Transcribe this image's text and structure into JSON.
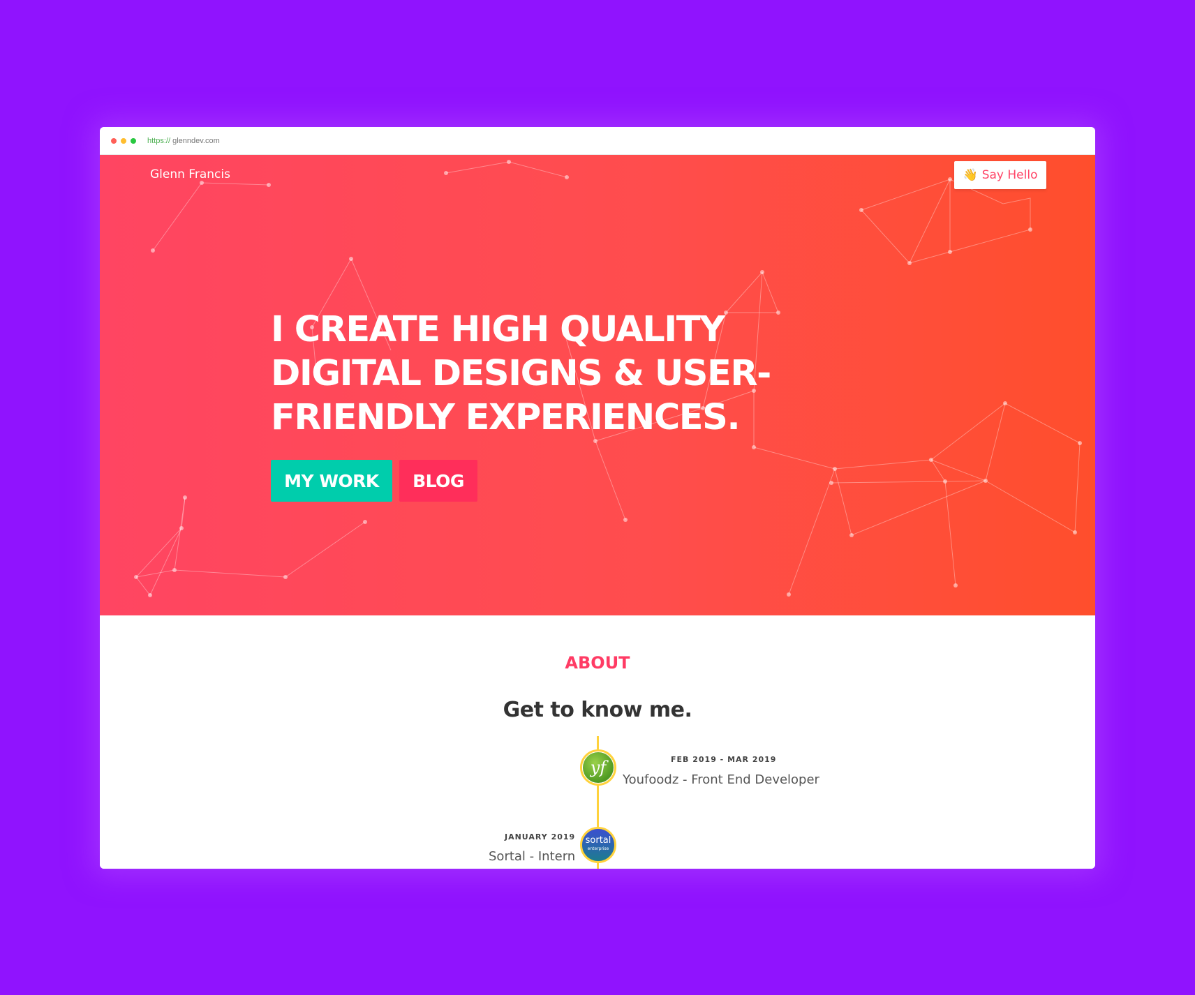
{
  "browser": {
    "url_scheme": "https://",
    "url_host": "glenndev.com",
    "dot_colors": [
      "#ff5f57",
      "#ffbd2e",
      "#28c840"
    ]
  },
  "nav": {
    "brand": "Glenn Francis",
    "say_hello_icon": "waving-hand-icon",
    "say_hello_label": "Say Hello"
  },
  "hero": {
    "headline": "I CREATE HIGH QUALITY DIGITAL DESIGNS & USER-FRIENDLY EXPERIENCES.",
    "my_work_label": "MY WORK",
    "blog_label": "BLOG",
    "colors": {
      "gradient_start": "#ff4562",
      "gradient_end": "#ff4e2c",
      "my_work_bg": "#00cdac",
      "blog_bg": "#ff2e5a"
    }
  },
  "about": {
    "label": "ABOUT",
    "title": "Get to know me.",
    "timeline": [
      {
        "date": "FEB 2019 - MAR 2019",
        "role": "Youfoodz - Front End Developer",
        "logo": "youfoodz-logo",
        "logo_text": "yf"
      },
      {
        "date": "JANUARY 2019",
        "role": "Sortal - Intern",
        "logo": "sortal-logo",
        "logo_text": "sortal",
        "logo_subtext": "enterprise"
      }
    ]
  }
}
